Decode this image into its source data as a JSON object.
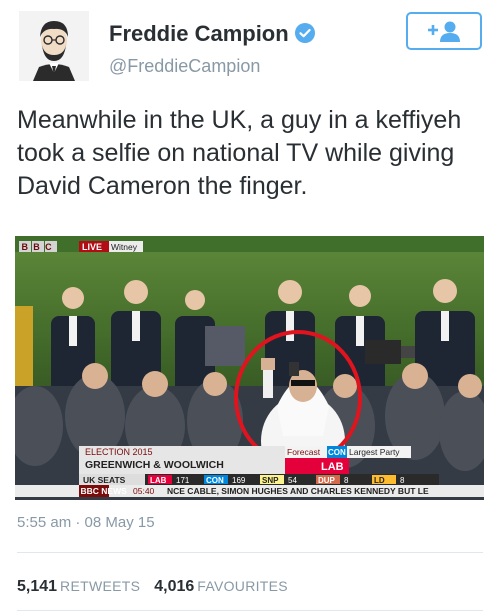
{
  "author": {
    "name": "Freddie Campion",
    "handle": "@FreddieCampion",
    "verified": true
  },
  "follow_button": {
    "icon": "follow-user-icon"
  },
  "tweet": {
    "text": "Meanwhile in the UK, a guy in a keffiyeh took a selfie on national TV while giving David Cameron the finger."
  },
  "media": {
    "broadcaster": "BBC",
    "live_label": "LIVE",
    "location": "Witney",
    "caption_line1": "ELECTION 2015",
    "caption_line2": "GREENWICH & WOOLWICH",
    "forecast_label": "Forecast",
    "forecast_con": "CON",
    "largest_party": "Largest Party",
    "forecast_result": "LAB",
    "seats_label": "UK SEATS",
    "seats": [
      {
        "party": "LAB",
        "count": "171",
        "color": "#e4003b"
      },
      {
        "party": "CON",
        "count": "169",
        "color": "#0087dc"
      },
      {
        "party": "SNP",
        "count": "54",
        "color": "#fdf38e"
      },
      {
        "party": "DUP",
        "count": "8",
        "color": "#d46a4c"
      },
      {
        "party": "LD",
        "count": "8",
        "color": "#fdbb30"
      }
    ],
    "news_label": "BBC NEWS",
    "news_time": "05:40",
    "news_ticker": "NCE CABLE, SIMON HUGHES AND CHARLES KENNEDY BUT LE",
    "highlight_color": "#e0141e"
  },
  "timestamp": "5:55 am · 08 May 15",
  "stats": {
    "retweets_count": "5,141",
    "retweets_label": "RETWEETS",
    "favourites_count": "4,016",
    "favourites_label": "FAVOURITES"
  },
  "colors": {
    "accent": "#55acee",
    "text": "#292f33",
    "muted": "#8899a6"
  }
}
